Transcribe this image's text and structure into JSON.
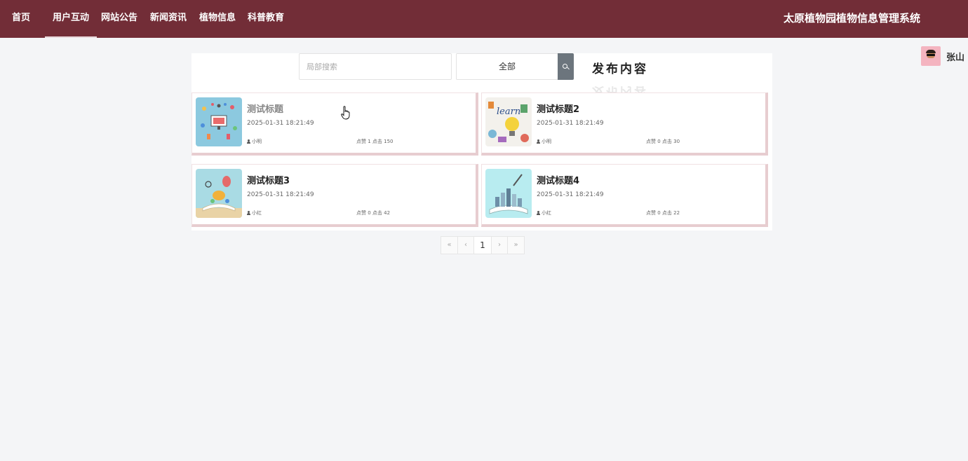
{
  "nav": {
    "items": [
      {
        "label": "首页",
        "active": false
      },
      {
        "label": "用户互动",
        "active": true
      },
      {
        "label": "网站公告",
        "active": false
      },
      {
        "label": "新闻资讯",
        "active": false
      },
      {
        "label": "植物信息",
        "active": false
      },
      {
        "label": "科普教育",
        "active": false
      }
    ],
    "site_title": "太原植物园植物信息管理系统"
  },
  "user": {
    "name": "张山",
    "avatar_icon": "avatar-icon"
  },
  "search": {
    "placeholder": "局部搜索",
    "category": "全部",
    "button_icon": "search-icon"
  },
  "publish_label": "发布内容",
  "posts": [
    {
      "title": "测试标题",
      "date": "2025-01-31 18:21:49",
      "author": "小明",
      "stats": "点赞 1 点击 150"
    },
    {
      "title": "测试标题2",
      "date": "2025-01-31 18:21:49",
      "author": "小明",
      "stats": "点赞 0 点击 30"
    },
    {
      "title": "测试标题3",
      "date": "2025-01-31 18:21:49",
      "author": "小红",
      "stats": "点赞 0 点击 42"
    },
    {
      "title": "测试标题4",
      "date": "2025-01-31 18:21:49",
      "author": "小红",
      "stats": "点赞 0 点击 22"
    }
  ],
  "pagination": {
    "first": "«",
    "prev": "‹",
    "current": "1",
    "next": "›",
    "last": "»"
  },
  "colors": {
    "header": "#722d37",
    "background": "#f4f5f7",
    "card_shadow": "#e7cdd0",
    "search_button": "#6c757d",
    "avatar": "#f4b4c0"
  }
}
